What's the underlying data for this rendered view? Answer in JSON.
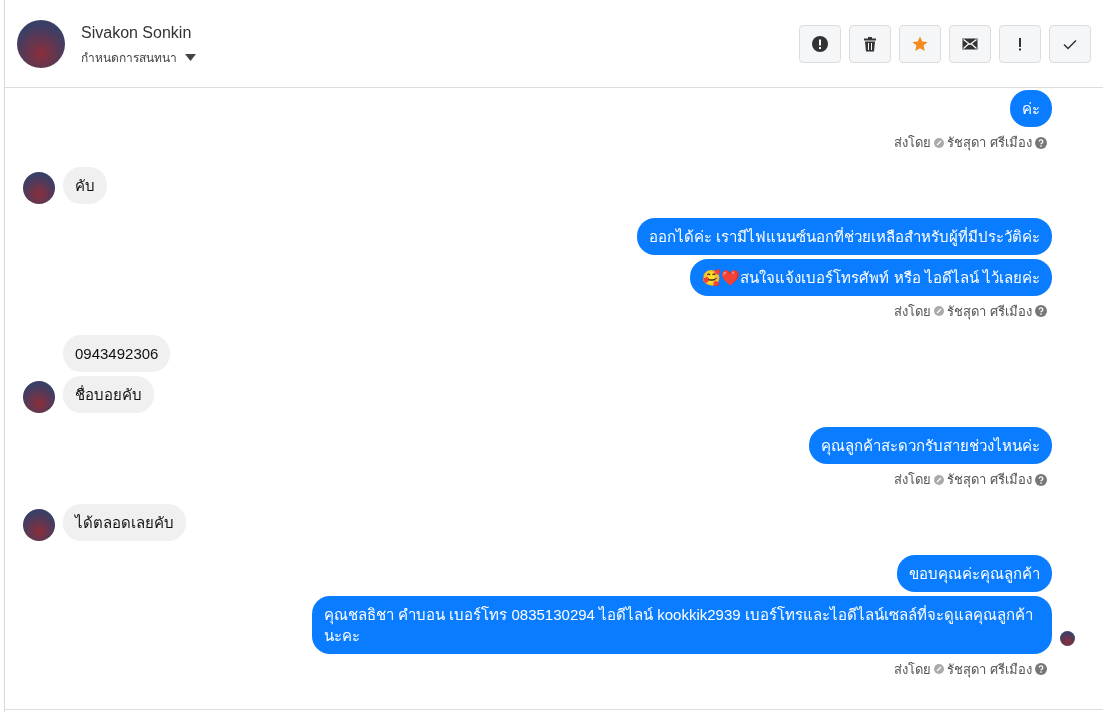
{
  "contact": {
    "name": "Sivakon Sonkin",
    "subtitle": "กำหนดการสนทนา"
  },
  "toolbar": {
    "starred": true
  },
  "messages": [
    {
      "kind": "outgoing",
      "bubbles": [
        "ค่ะ"
      ],
      "sent_by_label": "ส่งโดย",
      "agent": "รัชสุดา ศรีเมือง",
      "seen": false
    },
    {
      "kind": "incoming",
      "bubbles": [
        "คับ"
      ]
    },
    {
      "kind": "outgoing",
      "bubbles": [
        "ออกได้ค่ะ เรามีไฟแนนซ์นอกที่ช่วยเหลือสำหรับผู้ที่มีประวัติค่ะ",
        "🥰❤️สนใจแจ้งเบอร์โทรศัพท์ หรือ ไอดีไลน์  ไว้เลยค่ะ"
      ],
      "sent_by_label": "ส่งโดย",
      "agent": "รัชสุดา ศรีเมือง",
      "seen": false
    },
    {
      "kind": "incoming",
      "bubbles": [
        "0943492306",
        "ชื่อบอยคับ"
      ]
    },
    {
      "kind": "outgoing",
      "bubbles": [
        "คุณลูกค้าสะดวกรับสายช่วงไหนค่ะ"
      ],
      "sent_by_label": "ส่งโดย",
      "agent": "รัชสุดา ศรีเมือง",
      "seen": false
    },
    {
      "kind": "incoming",
      "bubbles": [
        "ได้ตลอดเลยคับ"
      ]
    },
    {
      "kind": "outgoing",
      "bubbles": [
        "ขอบคุณค่ะคุณลูกค้า",
        "คุณชลธิชา คำบอน เบอร์โทร 0835130294  ไอดีไลน์ kookkik2939  เบอร์โทรและไอดีไลน์เซลล์ที่จะดูแลคุณลูกค้านะคะ"
      ],
      "sent_by_label": "ส่งโดย",
      "agent": "รัชสุดา ศรีเมือง",
      "seen": true
    }
  ]
}
